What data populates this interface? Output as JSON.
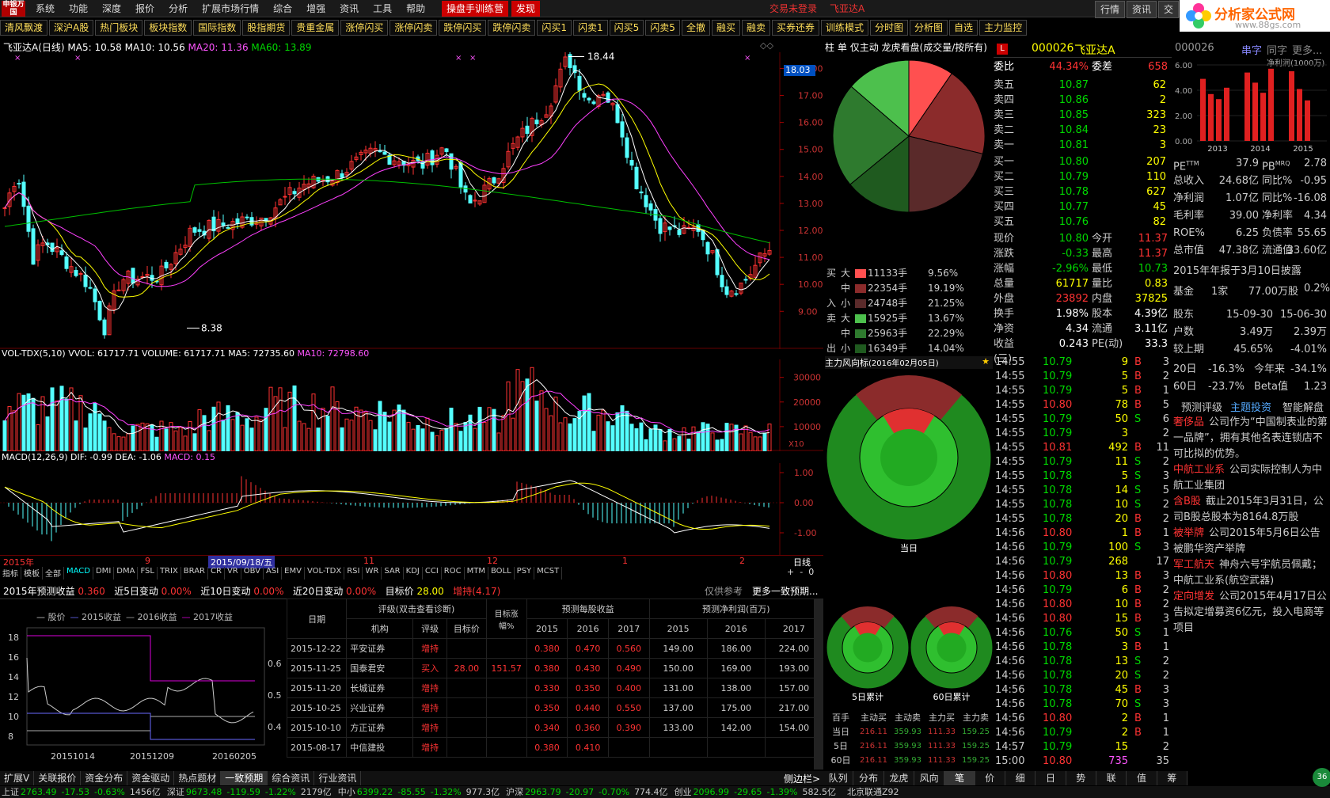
{
  "menu": {
    "logo": "申银万国",
    "items": [
      "系统",
      "功能",
      "深度",
      "报价",
      "分析",
      "扩展市场行情",
      "综合",
      "增强",
      "资讯",
      "工具",
      "帮助"
    ],
    "training": "操盘手训练营",
    "discover": "发现",
    "not_logged": "交易未登录",
    "stock": "飞亚达A",
    "right": [
      "行情",
      "资讯",
      "交"
    ]
  },
  "watermark": {
    "title": "分析家公式网",
    "url": "www.88gs.com"
  },
  "toolbar": [
    "清风飘渡",
    "深沪A股",
    "热门板块",
    "板块指数",
    "国际指数",
    "股指期货",
    "贵重金属",
    "涨停闪买",
    "涨停闪卖",
    "跌停闪买",
    "跌停闪卖",
    "闪买1",
    "闪卖1",
    "闪买5",
    "闪卖5",
    "全撤",
    "融买",
    "融卖",
    "买券还券",
    "训练模式",
    "分时图",
    "分析图",
    "自选",
    "主力监控"
  ],
  "chart": {
    "title_stock": "飞亚达A(日线)",
    "ma5": "MA5: 10.58",
    "ma10": "MA10: 10.56",
    "ma20": "MA20: 11.36",
    "ma60": "MA60: 13.89",
    "price_tag": "18.03",
    "high_label": "18.44",
    "low_label": "8.38",
    "y_ticks": [
      "18.00",
      "17.00",
      "16.00",
      "15.00",
      "14.00",
      "13.00",
      "12.00",
      "11.00",
      "10.00",
      "9.00"
    ],
    "vol_header": {
      "name": "VOL-TDX(5,10)",
      "vvol": "VVOL: 61717.71",
      "volume": "VOLUME: 61717.71",
      "ma5": "MA5: 72735.60",
      "ma10": "MA10: 72798.60"
    },
    "vol_ticks": [
      "30000",
      "20000",
      "10000"
    ],
    "vol_unit": "X10",
    "macd_header": {
      "name": "MACD(12,26,9)",
      "dif": "DIF: -0.99",
      "dea": "DEA: -1.06",
      "macd": "MACD: 0.15"
    },
    "macd_ticks": [
      "1.00",
      "0.00",
      "-1.00"
    ],
    "date_axis": {
      "year": "2015年",
      "d1": "9",
      "cursor": "2015/09/18/五",
      "d2": "11",
      "d3": "12",
      "d4": "1",
      "d5": "2",
      "period": "日线"
    },
    "top_right_icons": [
      "+",
      "-",
      "0"
    ]
  },
  "indicator_tabs": [
    "指标",
    "模板",
    "全部",
    "MACD",
    "DMI",
    "DMA",
    "FSL",
    "TRIX",
    "BRAR",
    "CR",
    "VR",
    "OBV",
    "ASI",
    "EMV",
    "VOL-TDX",
    "RSI",
    "WR",
    "SAR",
    "KDJ",
    "CCI",
    "ROC",
    "MTM",
    "BOLL",
    "PSY",
    "MCST"
  ],
  "forecast": {
    "label": "2015年预测收益",
    "eps": "0.360",
    "c5_label": "近5日变动",
    "c5": "0.00%",
    "c10_label": "近10日变动",
    "c10": "0.00%",
    "c20_label": "近20日变动",
    "c20": "0.00%",
    "target_label": "目标价",
    "target": "28.00",
    "rating": "增持(4.17)",
    "ref": "仅供参考",
    "more": "更多一致预期..."
  },
  "eps_chart": {
    "legend": [
      "股价",
      "2015收益",
      "2016收益",
      "2017收益"
    ],
    "left_ticks": [
      "18",
      "16",
      "14",
      "12",
      "10",
      "8"
    ],
    "right_ticks": [
      "0.6",
      "0.5",
      "0.4"
    ],
    "x_labels": [
      "20151014",
      "20151209",
      "20160205"
    ]
  },
  "ftable": {
    "h_date": "日期",
    "h_rating_group": "评级(双击查看诊断)",
    "h_target_up": "目标涨幅%",
    "h_eps": "预测每股收益",
    "h_np": "预测净利润(百万)",
    "h_org": "机构",
    "h_rate": "评级",
    "h_target": "目标价",
    "years": [
      "2015",
      "2016",
      "2017"
    ],
    "rows": [
      {
        "date": "2015-12-22",
        "org": "平安证券",
        "rate": "增持",
        "target": "",
        "up": "",
        "e15": "0.380",
        "e16": "0.470",
        "e17": "0.560",
        "n15": "149.00",
        "n16": "186.00",
        "n17": "224.00"
      },
      {
        "date": "2015-11-25",
        "org": "国泰君安",
        "rate": "买入",
        "target": "28.00",
        "up": "151.57",
        "e15": "0.380",
        "e16": "0.430",
        "e17": "0.490",
        "n15": "150.00",
        "n16": "169.00",
        "n17": "193.00"
      },
      {
        "date": "2015-11-20",
        "org": "长城证券",
        "rate": "增持",
        "target": "",
        "up": "",
        "e15": "0.330",
        "e16": "0.350",
        "e17": "0.400",
        "n15": "131.00",
        "n16": "138.00",
        "n17": "157.00"
      },
      {
        "date": "2015-10-25",
        "org": "兴业证券",
        "rate": "增持",
        "target": "",
        "up": "",
        "e15": "0.350",
        "e16": "0.440",
        "e17": "0.550",
        "n15": "137.00",
        "n16": "175.00",
        "n17": "217.00"
      },
      {
        "date": "2015-10-10",
        "org": "方正证券",
        "rate": "增持",
        "target": "",
        "up": "",
        "e15": "0.340",
        "e16": "0.360",
        "e17": "0.390",
        "n15": "133.00",
        "n16": "142.00",
        "n17": "154.00"
      },
      {
        "date": "2015-08-17",
        "org": "中信建投",
        "rate": "增持",
        "target": "",
        "up": "",
        "e15": "0.380",
        "e16": "0.410",
        "e17": "",
        "n15": "",
        "n16": "",
        "n17": ""
      }
    ]
  },
  "flow": {
    "tabs": [
      "柱",
      "单",
      "仅主动",
      "龙虎看盘(成交量/按所有)"
    ],
    "buy": [
      {
        "size": "大",
        "hands": "11133手",
        "pct": "9.56%"
      },
      {
        "size": "中",
        "hands": "22354手",
        "pct": "19.19%"
      },
      {
        "size": "小",
        "hands": "24748手",
        "pct": "21.25%"
      }
    ],
    "sell": [
      {
        "size": "大",
        "hands": "15925手",
        "pct": "13.67%"
      },
      {
        "size": "中",
        "hands": "25963手",
        "pct": "22.29%"
      },
      {
        "size": "小",
        "hands": "16349手",
        "pct": "14.04%"
      }
    ],
    "buy_side": [
      "买",
      "入"
    ],
    "sell_side": [
      "卖",
      "出"
    ],
    "wind_title": "主力风向标",
    "wind_date": "(2016年02月05日)",
    "today": "当日",
    "d5": "5日累计",
    "d60": "60日累计",
    "table_head": [
      "百手",
      "主动买",
      "主动卖",
      "主力买",
      "主力卖"
    ],
    "table_rows": [
      {
        "l": "当日",
        "a": "216.11",
        "b": "359.93",
        "c": "111.33",
        "d": "159.25"
      },
      {
        "l": "5日",
        "a": "216.11",
        "b": "359.93",
        "c": "111.33",
        "d": "159.25"
      },
      {
        "l": "60日",
        "a": "216.11",
        "b": "359.93",
        "c": "111.33",
        "d": "159.25"
      }
    ]
  },
  "quote": {
    "code": "000026",
    "name": "飞亚达A",
    "ratio_label": "委比",
    "ratio": "44.34%",
    "diff_label": "委差",
    "diff": "658",
    "asks": [
      {
        "l": "卖五",
        "p": "10.87",
        "v": "62"
      },
      {
        "l": "卖四",
        "p": "10.86",
        "v": "2"
      },
      {
        "l": "卖三",
        "p": "10.85",
        "v": "323"
      },
      {
        "l": "卖二",
        "p": "10.84",
        "v": "23"
      },
      {
        "l": "卖一",
        "p": "10.81",
        "v": "3"
      }
    ],
    "bids": [
      {
        "l": "买一",
        "p": "10.80",
        "v": "207"
      },
      {
        "l": "买二",
        "p": "10.79",
        "v": "110"
      },
      {
        "l": "买三",
        "p": "10.78",
        "v": "627"
      },
      {
        "l": "买四",
        "p": "10.77",
        "v": "45"
      },
      {
        "l": "买五",
        "p": "10.76",
        "v": "82"
      }
    ],
    "stats": [
      {
        "l1": "现价",
        "v1": "10.80",
        "c1": "green",
        "l2": "今开",
        "v2": "11.37",
        "c2": "red"
      },
      {
        "l1": "涨跌",
        "v1": "-0.33",
        "c1": "green",
        "l2": "最高",
        "v2": "11.37",
        "c2": "red"
      },
      {
        "l1": "涨幅",
        "v1": "-2.96%",
        "c1": "green",
        "l2": "最低",
        "v2": "10.73",
        "c2": "green"
      },
      {
        "l1": "总量",
        "v1": "61717",
        "c1": "yellow",
        "l2": "量比",
        "v2": "0.83",
        "c2": "yellow"
      },
      {
        "l1": "外盘",
        "v1": "23892",
        "c1": "red",
        "l2": "内盘",
        "v2": "37825",
        "c2": "yellow"
      },
      {
        "l1": "换手",
        "v1": "1.98%",
        "c1": "white",
        "l2": "股本",
        "v2": "4.39亿",
        "c2": "white"
      },
      {
        "l1": "净资",
        "v1": "4.34",
        "c1": "white",
        "l2": "流通",
        "v2": "3.11亿",
        "c2": "white"
      },
      {
        "l1": "收益(三)",
        "v1": "0.243",
        "c1": "white",
        "l2": "PE(动)",
        "v2": "33.3",
        "c2": "white"
      }
    ]
  },
  "ticks": [
    {
      "t": "14:55",
      "p": "10.79",
      "v": "9",
      "s": "B",
      "n": "3"
    },
    {
      "t": "14:55",
      "p": "10.79",
      "v": "5",
      "s": "B",
      "n": "2"
    },
    {
      "t": "14:55",
      "p": "10.79",
      "v": "5",
      "s": "B",
      "n": "1"
    },
    {
      "t": "14:55",
      "p": "10.80",
      "v": "78",
      "s": "B",
      "n": "5"
    },
    {
      "t": "14:55",
      "p": "10.79",
      "v": "50",
      "s": "S",
      "n": "6"
    },
    {
      "t": "14:55",
      "p": "10.79",
      "v": "3",
      "s": "",
      "n": "2"
    },
    {
      "t": "14:55",
      "p": "10.81",
      "v": "492",
      "s": "B",
      "n": "11"
    },
    {
      "t": "14:55",
      "p": "10.79",
      "v": "11",
      "s": "S",
      "n": "2"
    },
    {
      "t": "14:55",
      "p": "10.78",
      "v": "5",
      "s": "S",
      "n": "3"
    },
    {
      "t": "14:55",
      "p": "10.78",
      "v": "14",
      "s": "S",
      "n": "5"
    },
    {
      "t": "14:55",
      "p": "10.78",
      "v": "10",
      "s": "S",
      "n": "2"
    },
    {
      "t": "14:55",
      "p": "10.78",
      "v": "20",
      "s": "B",
      "n": "2"
    },
    {
      "t": "14:56",
      "p": "10.80",
      "v": "1",
      "s": "B",
      "n": "1"
    },
    {
      "t": "14:56",
      "p": "10.79",
      "v": "100",
      "s": "S",
      "n": "3"
    },
    {
      "t": "14:56",
      "p": "10.79",
      "v": "268",
      "s": "",
      "n": "17"
    },
    {
      "t": "14:56",
      "p": "10.80",
      "v": "13",
      "s": "B",
      "n": "3"
    },
    {
      "t": "14:56",
      "p": "10.79",
      "v": "6",
      "s": "B",
      "n": "2"
    },
    {
      "t": "14:56",
      "p": "10.80",
      "v": "10",
      "s": "B",
      "n": "2"
    },
    {
      "t": "14:56",
      "p": "10.80",
      "v": "15",
      "s": "B",
      "n": "3"
    },
    {
      "t": "14:56",
      "p": "10.76",
      "v": "50",
      "s": "S",
      "n": "1"
    },
    {
      "t": "14:56",
      "p": "10.78",
      "v": "3",
      "s": "B",
      "n": "1"
    },
    {
      "t": "14:56",
      "p": "10.78",
      "v": "13",
      "s": "S",
      "n": "2"
    },
    {
      "t": "14:56",
      "p": "10.78",
      "v": "20",
      "s": "S",
      "n": "2"
    },
    {
      "t": "14:56",
      "p": "10.78",
      "v": "45",
      "s": "B",
      "n": "3"
    },
    {
      "t": "14:56",
      "p": "10.78",
      "v": "70",
      "s": "S",
      "n": "3"
    },
    {
      "t": "14:56",
      "p": "10.80",
      "v": "2",
      "s": "B",
      "n": "1"
    },
    {
      "t": "14:56",
      "p": "10.79",
      "v": "2",
      "s": "B",
      "n": "1"
    },
    {
      "t": "14:57",
      "p": "10.79",
      "v": "15",
      "s": "",
      "n": "2"
    },
    {
      "t": "15:00",
      "p": "10.80",
      "v": "735",
      "s": "",
      "n": "35"
    }
  ],
  "f10": {
    "code": "000026",
    "tabs": [
      "串字",
      "同字",
      "更多..."
    ],
    "np_label": "净利润(1000万)",
    "np_ticks": [
      "6.00",
      "4.00",
      "2.00",
      "0.00"
    ],
    "years": [
      "2013",
      "2014",
      "2015"
    ],
    "bars": [
      {
        "group": "2013",
        "values": [
          4.9,
          3.7,
          3.3,
          4.2
        ]
      },
      {
        "group": "2014",
        "values": [
          5.4,
          4.6,
          3.8,
          5.7
        ]
      },
      {
        "group": "2015",
        "values": [
          5.5,
          4.1,
          3.2
        ]
      }
    ],
    "rows": [
      {
        "a": "PE",
        "b": "37.9",
        "c": "PB",
        "d": "2.78",
        "sup1": "TTM",
        "sup2": "MRQ"
      },
      {
        "a": "总收入",
        "b": "24.68亿",
        "c": "同比%",
        "d": "-0.95"
      },
      {
        "a": "净利润",
        "b": "1.07亿",
        "c": "同比%",
        "d": "-16.08"
      },
      {
        "a": "毛利率",
        "b": "39.00",
        "c": "净利率",
        "d": "4.34"
      },
      {
        "a": "ROE%",
        "b": "6.25",
        "c": "负债率",
        "d": "55.65"
      },
      {
        "a": "总市值",
        "b": "47.38亿",
        "c": "流通值",
        "d": "33.60亿"
      }
    ],
    "report": "2015年年报于3月10日披露",
    "fund": {
      "a": "基金",
      "b": "1家",
      "c": "77.00万股",
      "d": "0.2%"
    },
    "holders": [
      {
        "a": "股东",
        "b": "15-09-30",
        "c": "15-06-30"
      },
      {
        "a": "户数",
        "b": "3.49万",
        "c": "2.39万"
      },
      {
        "a": "较上期",
        "b": "45.65%",
        "c": "-4.01%"
      }
    ],
    "perf": [
      {
        "a": "20日",
        "b": "-16.3%",
        "c": "今年来",
        "d": "-34.1%"
      },
      {
        "a": "60日",
        "b": "-23.7%",
        "c": "Beta值",
        "d": "1.23"
      }
    ],
    "tags": [
      "预测评级",
      "主题投资",
      "智能解盘"
    ],
    "themes": [
      {
        "k": "奢侈品",
        "t": "公司作为“中国制表业的第一品牌”，拥有其他名表连锁店不可比拟的优势。"
      },
      {
        "k": "中航工业系",
        "t": "公司实际控制人为中航工业集团"
      },
      {
        "k": "含B股",
        "t": "截止2015年3月31日，公司B股总股本为8164.8万股"
      },
      {
        "k": "被举牌",
        "t": "公司2015年5月6日公告被鹏华资产举牌"
      },
      {
        "k": "军工航天",
        "t": "神舟六号宇航员佩戴；中航工业系(航空武器)"
      },
      {
        "k": "定向增发",
        "t": "公司2015年4月17日公告拟定增募资6亿元，投入电商等项目"
      }
    ]
  },
  "bottom_tabs": [
    "扩展V",
    "关联报价",
    "资金分布",
    "资金驱动",
    "热点题材",
    "一致预期",
    "综合资讯",
    "行业资讯"
  ],
  "side_toggle": "侧边栏>",
  "right_tabs": [
    "队列",
    "分布",
    "龙虎",
    "风向",
    "笔",
    "价",
    "细",
    "日",
    "势",
    "联",
    "值",
    "筹"
  ],
  "status": [
    {
      "n": "上证",
      "v": "2763.49",
      "c": "-17.53",
      "p": "-0.63%",
      "a": "1456亿"
    },
    {
      "n": "深证",
      "v": "9673.48",
      "c": "-119.59",
      "p": "-1.22%",
      "a": "2179亿"
    },
    {
      "n": "中小",
      "v": "6399.22",
      "c": "-85.55",
      "p": "-1.32%",
      "a": "977.3亿"
    },
    {
      "n": "沪深",
      "v": "2963.79",
      "c": "-20.97",
      "p": "-0.70%",
      "a": "774.4亿"
    },
    {
      "n": "创业",
      "v": "2096.99",
      "c": "-29.65",
      "p": "-1.39%",
      "a": "582.5亿"
    }
  ],
  "conn": "北京联通Z92",
  "badge": "36"
}
